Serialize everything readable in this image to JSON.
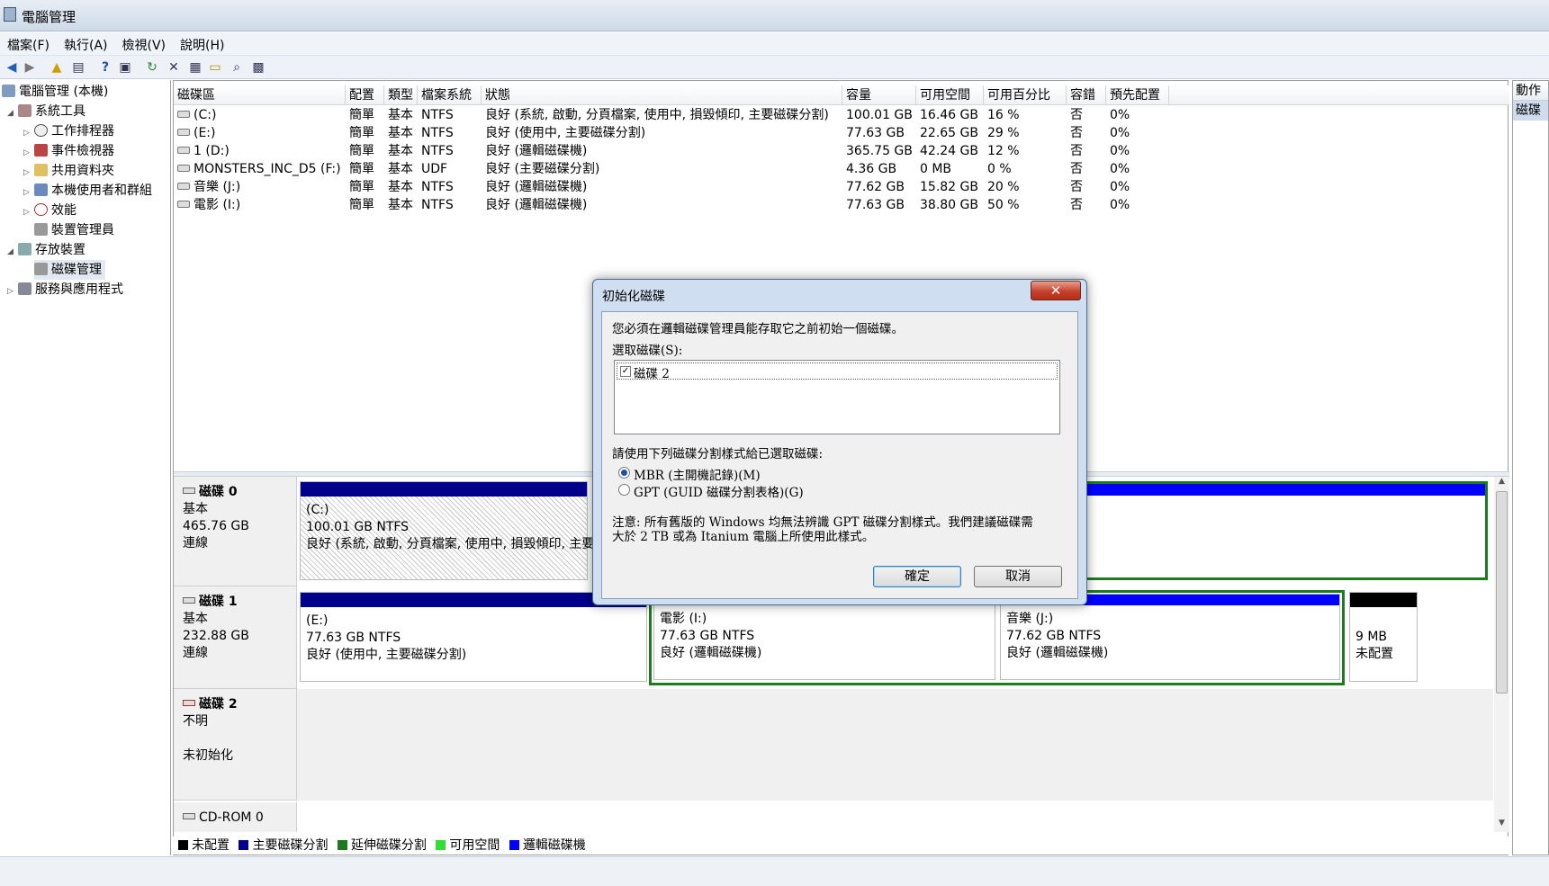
{
  "window": {
    "title": "電腦管理"
  },
  "menu": [
    "檔案(F)",
    "執行(A)",
    "檢視(V)",
    "說明(H)"
  ],
  "toolbar": [
    "back-icon",
    "forward-icon",
    "up-icon",
    "show-tree-icon",
    "help-icon",
    "properties-icon",
    "refresh-icon",
    "delete-icon",
    "properties2-icon",
    "open-icon",
    "search-icon",
    "export-icon"
  ],
  "tree": {
    "root": "電腦管理 (本機)",
    "system_tools": "系統工具",
    "task_scheduler": "工作排程器",
    "event_viewer": "事件檢視器",
    "shared_folders": "共用資料夾",
    "local_users": "本機使用者和群組",
    "performance": "效能",
    "device_manager": "裝置管理員",
    "storage": "存放裝置",
    "disk_management": "磁碟管理",
    "services": "服務與應用程式"
  },
  "volumes": {
    "columns": [
      "磁碟區",
      "配置",
      "類型",
      "檔案系統",
      "狀態",
      "容量",
      "可用空間",
      "可用百分比",
      "容錯",
      "預先配置"
    ],
    "rows": [
      [
        "(C:)",
        "簡單",
        "基本",
        "NTFS",
        "良好 (系統, 啟動, 分頁檔案, 使用中, 損毀傾印, 主要磁碟分割)",
        "100.01 GB",
        "16.46 GB",
        "16 %",
        "否",
        "0%"
      ],
      [
        "(E:)",
        "簡單",
        "基本",
        "NTFS",
        "良好 (使用中, 主要磁碟分割)",
        "77.63 GB",
        "22.65 GB",
        "29 %",
        "否",
        "0%"
      ],
      [
        "1 (D:)",
        "簡單",
        "基本",
        "NTFS",
        "良好 (邏輯磁碟機)",
        "365.75 GB",
        "42.24 GB",
        "12 %",
        "否",
        "0%"
      ],
      [
        "MONSTERS_INC_D5 (F:)",
        "簡單",
        "基本",
        "UDF",
        "良好 (主要磁碟分割)",
        "4.36 GB",
        "0 MB",
        "0 %",
        "否",
        "0%"
      ],
      [
        "音樂 (J:)",
        "簡單",
        "基本",
        "NTFS",
        "良好 (邏輯磁碟機)",
        "77.62 GB",
        "15.82 GB",
        "20 %",
        "否",
        "0%"
      ],
      [
        "電影 (I:)",
        "簡單",
        "基本",
        "NTFS",
        "良好 (邏輯磁碟機)",
        "77.63 GB",
        "38.80 GB",
        "50 %",
        "否",
        "0%"
      ]
    ]
  },
  "disks": {
    "disk0": {
      "name": "磁碟 0",
      "type": "基本",
      "size": "465.76 GB",
      "status": "連線",
      "p0": {
        "name": "(C:)",
        "size": "100.01 GB NTFS",
        "status": "良好 (系統, 啟動, 分頁檔案, 使用中, 損毀傾印, 主要"
      }
    },
    "disk1": {
      "name": "磁碟 1",
      "type": "基本",
      "size": "232.88 GB",
      "status": "連線",
      "p0": {
        "name": "(E:)",
        "size": "77.63 GB NTFS",
        "status": "良好 (使用中, 主要磁碟分割)"
      },
      "p1": {
        "name": "電影  (I:)",
        "size": "77.63 GB NTFS",
        "status": "良好 (邏輯磁碟機)"
      },
      "p2": {
        "name": "音樂  (J:)",
        "size": "77.62 GB NTFS",
        "status": "良好 (邏輯磁碟機)"
      },
      "p3": {
        "size": "9 MB",
        "status": "未配置"
      }
    },
    "disk2": {
      "name": "磁碟 2",
      "type": "不明",
      "status": "未初始化"
    },
    "cdrom": {
      "name": "CD-ROM 0"
    }
  },
  "legend": [
    "未配置",
    "主要磁碟分割",
    "延伸磁碟分割",
    "可用空間",
    "邏輯磁碟機"
  ],
  "colors": {
    "unallocated": "#000000",
    "primary": "#00008b",
    "extended": "#1e7a1e",
    "free": "#33dd33",
    "logical": "#0000ff"
  },
  "action_pane": {
    "header": "動作",
    "item": "磁碟"
  },
  "dialog": {
    "title": "初始化磁碟",
    "message": "您必須在邏輯磁碟管理員能存取它之前初始一個磁碟。",
    "select_label": "選取磁碟(S):",
    "disk_item": "磁碟 2",
    "style_label": "請使用下列磁碟分割樣式給已選取磁碟:",
    "mbr": "MBR (主開機記錄)(M)",
    "gpt": "GPT (GUID 磁碟分割表格)(G)",
    "note1": "注意: 所有舊版的 Windows 均無法辨識 GPT 磁碟分割樣式。我們建議磁碟需",
    "note2": "大於 2 TB 或為 Itanium 電腦上所使用此樣式。",
    "ok": "確定",
    "cancel": "取消",
    "close": "✕"
  }
}
